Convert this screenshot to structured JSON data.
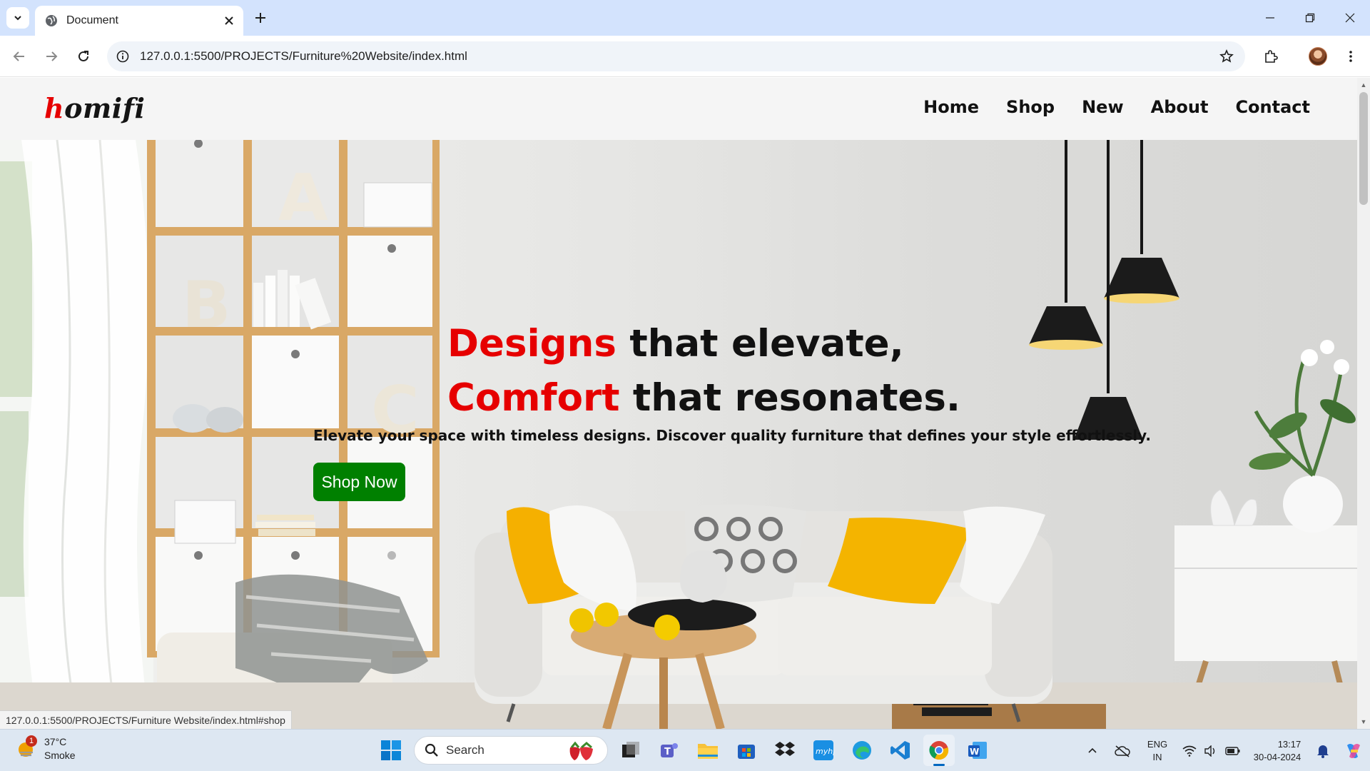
{
  "browser": {
    "tab_title": "Document",
    "url": "127.0.0.1:5500/PROJECTS/Furniture%20Website/index.html",
    "status_url": "127.0.0.1:5500/PROJECTS/Furniture Website/index.html#shop"
  },
  "site": {
    "logo_first": "h",
    "logo_rest": "omifi",
    "nav": [
      "Home",
      "Shop",
      "New",
      "About",
      "Contact"
    ],
    "hero": {
      "line1_highlight": "Designs",
      "line1_rest": " that elevate,",
      "line2_highlight": "Comfort",
      "line2_rest": " that resonates.",
      "subtitle": "Elevate your space with timeless designs. Discover quality furniture that defines your style effortlessly.",
      "cta": "Shop Now"
    },
    "colors": {
      "accent": "#e60000",
      "cta": "#008000",
      "text": "#111111"
    }
  },
  "taskbar": {
    "weather_temp": "37°C",
    "weather_desc": "Smoke",
    "weather_badge": "1",
    "search_label": "Search",
    "lang_line1": "ENG",
    "lang_line2": "IN",
    "time": "13:17",
    "date": "30-04-2024",
    "apps": [
      "start-icon",
      "task-view-icon",
      "teams-icon",
      "file-explorer-icon",
      "store-icon",
      "dropbox-icon",
      "myhp-icon",
      "edge-icon",
      "vscode-icon",
      "chrome-icon",
      "word-icon"
    ]
  }
}
